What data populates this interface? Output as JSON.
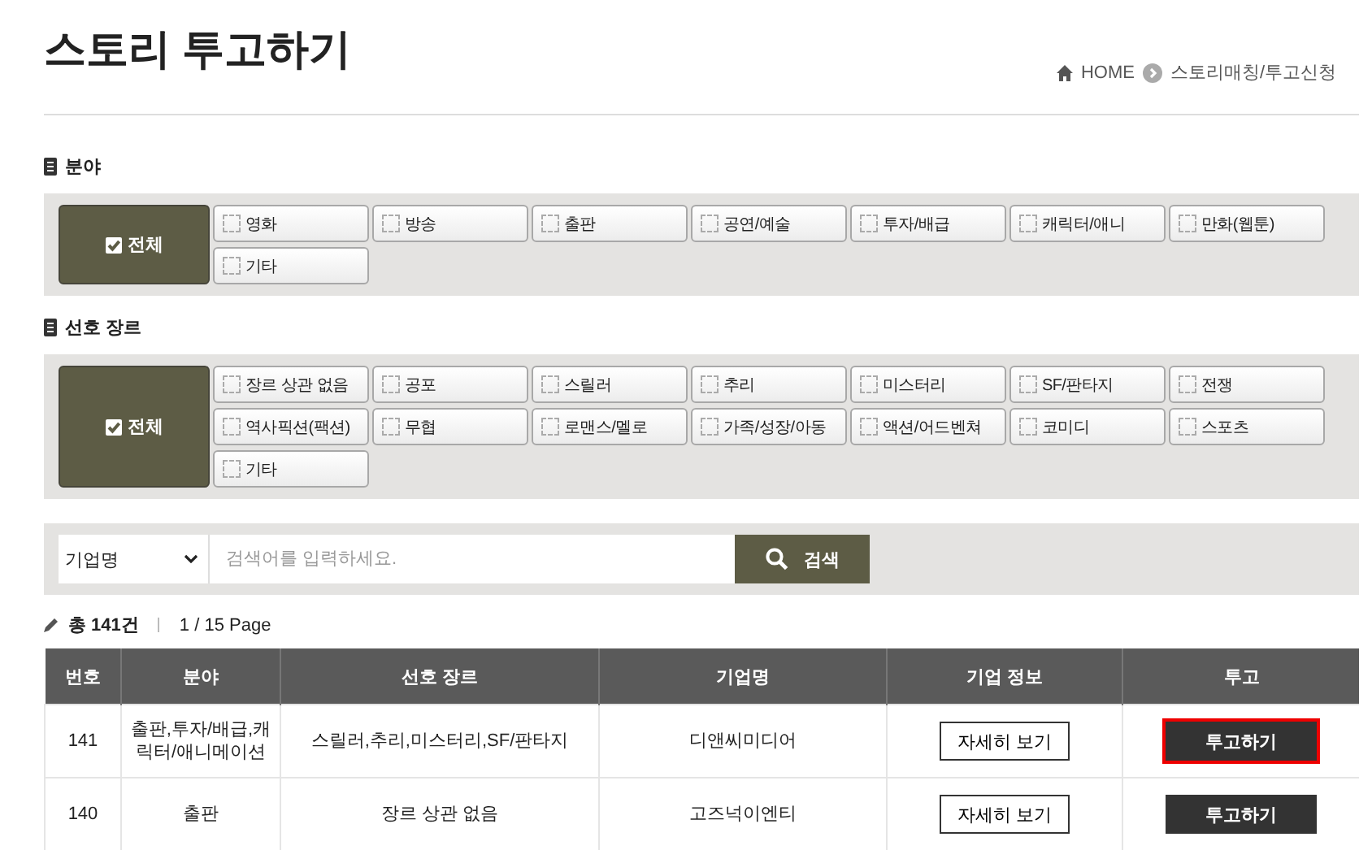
{
  "title": "스토리 투고하기",
  "breadcrumb": [
    "HOME",
    "스토리매칭/투고신청"
  ],
  "filters": [
    {
      "label": "분야",
      "all": {
        "label": "전체",
        "checked": true
      },
      "options": [
        {
          "label": "영화",
          "checked": false
        },
        {
          "label": "방송",
          "checked": false
        },
        {
          "label": "출판",
          "checked": false
        },
        {
          "label": "공연/예술",
          "checked": false
        },
        {
          "label": "투자/배급",
          "checked": false
        },
        {
          "label": "캐릭터/애니",
          "checked": false
        },
        {
          "label": "만화(웹툰)",
          "checked": false
        },
        {
          "label": "기타",
          "checked": false
        }
      ]
    },
    {
      "label": "선호 장르",
      "all": {
        "label": "전체",
        "checked": true
      },
      "options": [
        {
          "label": "장르 상관 없음",
          "checked": false
        },
        {
          "label": "공포",
          "checked": false
        },
        {
          "label": "스릴러",
          "checked": false
        },
        {
          "label": "추리",
          "checked": false
        },
        {
          "label": "미스터리",
          "checked": false
        },
        {
          "label": "SF/판타지",
          "checked": false
        },
        {
          "label": "전쟁",
          "checked": false
        },
        {
          "label": "역사픽션(팩션)",
          "checked": false
        },
        {
          "label": "무협",
          "checked": false
        },
        {
          "label": "로맨스/멜로",
          "checked": false
        },
        {
          "label": "가족/성장/아동",
          "checked": false
        },
        {
          "label": "액션/어드벤쳐",
          "checked": false
        },
        {
          "label": "코미디",
          "checked": false
        },
        {
          "label": "스포츠",
          "checked": false
        },
        {
          "label": "기타",
          "checked": false
        }
      ]
    }
  ],
  "search": {
    "select": "기업명",
    "placeholder": "검색어를 입력하세요.",
    "button": "검색"
  },
  "summary": {
    "total": "총 141건",
    "page": "1 / 15 Page"
  },
  "table": {
    "columns": [
      "번호",
      "분야",
      "선호 장르",
      "기업명",
      "기업 정보",
      "투고"
    ],
    "rows": [
      {
        "no": "141",
        "field": "출판,투자/배급,캐릭터/애니메이션",
        "genre": "스릴러,추리,미스터리,SF/판타지",
        "company": "디앤씨미디어",
        "info": "자세히 보기",
        "submit": "투고하기",
        "focused": true
      },
      {
        "no": "140",
        "field": "출판",
        "genre": "장르 상관 없음",
        "company": "고즈넉이엔티",
        "info": "자세히 보기",
        "submit": "투고하기",
        "focused": false
      }
    ]
  }
}
